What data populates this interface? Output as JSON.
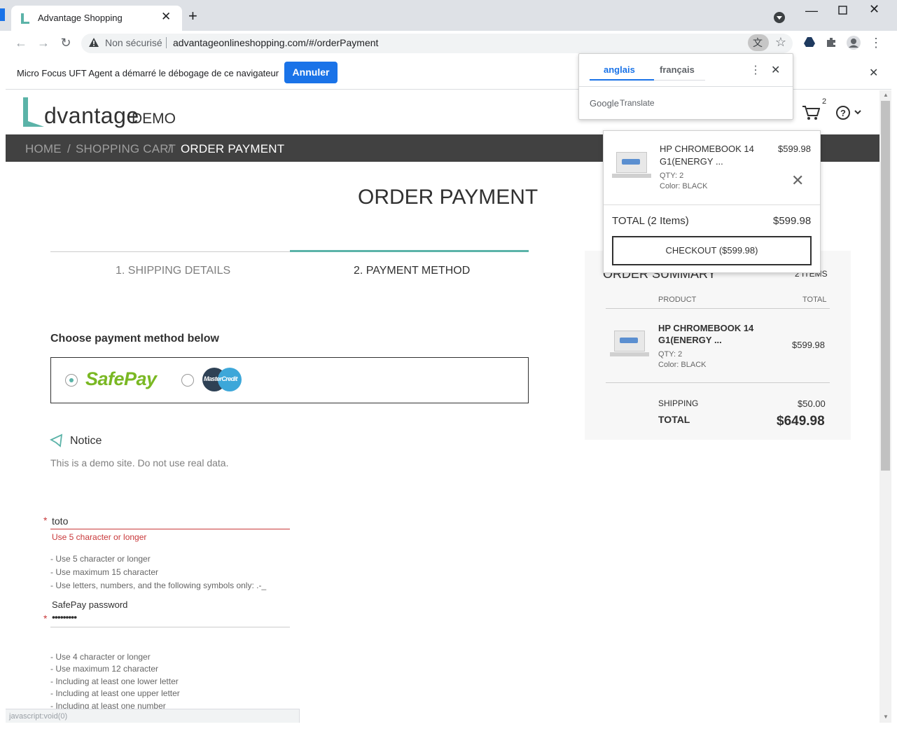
{
  "browser": {
    "tab_title": "Advantage Shopping",
    "new_tab_icon": "plus-icon",
    "security_label": "Non sécurisé",
    "url": "advantageonlineshopping.com/#/orderPayment",
    "status_url": "javascript:void(0)"
  },
  "infobar": {
    "message": "Micro Focus UFT Agent a démarré le débogage de ce navigateur",
    "cancel_label": "Annuler"
  },
  "translate": {
    "lang_source": "anglais",
    "lang_target": "français",
    "brand_google": "Google",
    "brand_translate": "Translate"
  },
  "site": {
    "logo_main": "dvantage",
    "logo_demo": "DEMO",
    "cart_count": "2",
    "breadcrumb": [
      "HOME",
      "SHOPPING CART",
      "ORDER PAYMENT"
    ],
    "page_title": "ORDER PAYMENT",
    "steps": [
      "1. SHIPPING DETAILS",
      "2. PAYMENT METHOD"
    ],
    "payment_heading": "Choose payment method below",
    "safepay_label": "SafePay",
    "mastercredit_label": "MasterCredit",
    "notice_title": "Notice",
    "notice_text": "This is a demo site. Do not use real data.",
    "username_value": "toto",
    "username_error": "Use 5 character or longer",
    "username_hints": [
      "- Use 5 character or longer",
      "- Use maximum 15 character",
      "- Use letters, numbers, and the following symbols only: .-_"
    ],
    "password_label": "SafePay password",
    "password_value": "•••••••••",
    "password_hints": [
      "- Use 4 character or longer",
      "- Use maximum 12 character",
      "- Including at least one lower letter",
      "- Including at least one upper letter",
      "- Including at least one number"
    ]
  },
  "summary": {
    "title": "ORDER SUMMARY",
    "items_count": "2 ITEMS",
    "col_product": "PRODUCT",
    "col_total": "TOTAL",
    "product_name_1": "HP CHROMEBOOK 14",
    "product_name_2": "G1(ENERGY ...",
    "product_qty": "QTY: 2",
    "product_color": "Color: BLACK",
    "product_price": "$599.98",
    "shipping_label": "SHIPPING",
    "shipping_value": "$50.00",
    "total_label": "TOTAL",
    "total_value": "$649.98"
  },
  "cart_popup": {
    "product_name_1": "HP CHROMEBOOK 14",
    "product_name_2": "G1(ENERGY ...",
    "product_qty": "QTY: 2",
    "product_color": "Color: BLACK",
    "product_price": "$599.98",
    "total_label": "TOTAL (2 Items)",
    "total_value": "$599.98",
    "checkout_label": "CHECKOUT ($599.98)"
  },
  "colors": {
    "accent_teal": "#5bb3a8",
    "error_red": "#c8383a",
    "chrome_blue": "#1a73e8",
    "breadcrumb_bg": "#414141"
  }
}
